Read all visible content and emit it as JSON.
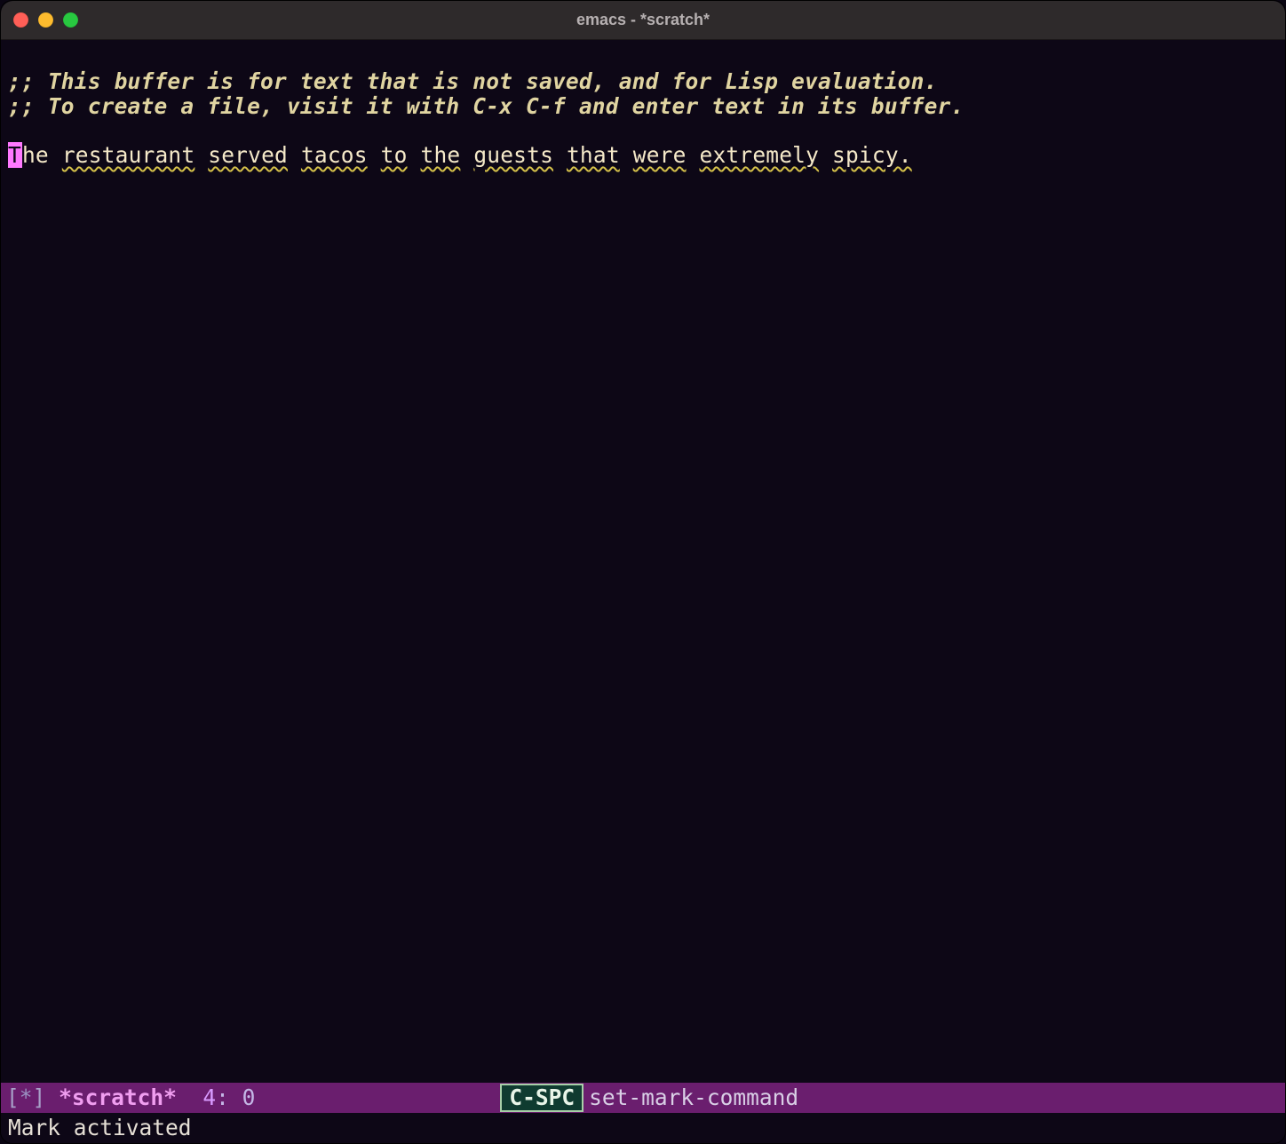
{
  "titlebar": {
    "title": "emacs - *scratch*"
  },
  "buffer": {
    "comment_line_1": ";; This buffer is for text that is not saved, and for Lisp evaluation.",
    "comment_line_2": ";; To create a file, visit it with C-x C-f and enter text in its buffer.",
    "text": {
      "cursor_char": "T",
      "after_cursor": "he ",
      "words": [
        "restaurant",
        "served",
        "tacos",
        "to",
        "the",
        "guests",
        "that",
        "were",
        "extremely",
        "spicy."
      ]
    }
  },
  "modeline": {
    "left_bracket": "[",
    "modified": "*",
    "right_bracket": "]",
    "buffer_name": "*scratch*",
    "line": "4",
    "colon": ":",
    "col": " 0",
    "keycast_key": "C-SPC",
    "keycast_cmd": "set-mark-command"
  },
  "echo": {
    "message": "Mark activated"
  }
}
